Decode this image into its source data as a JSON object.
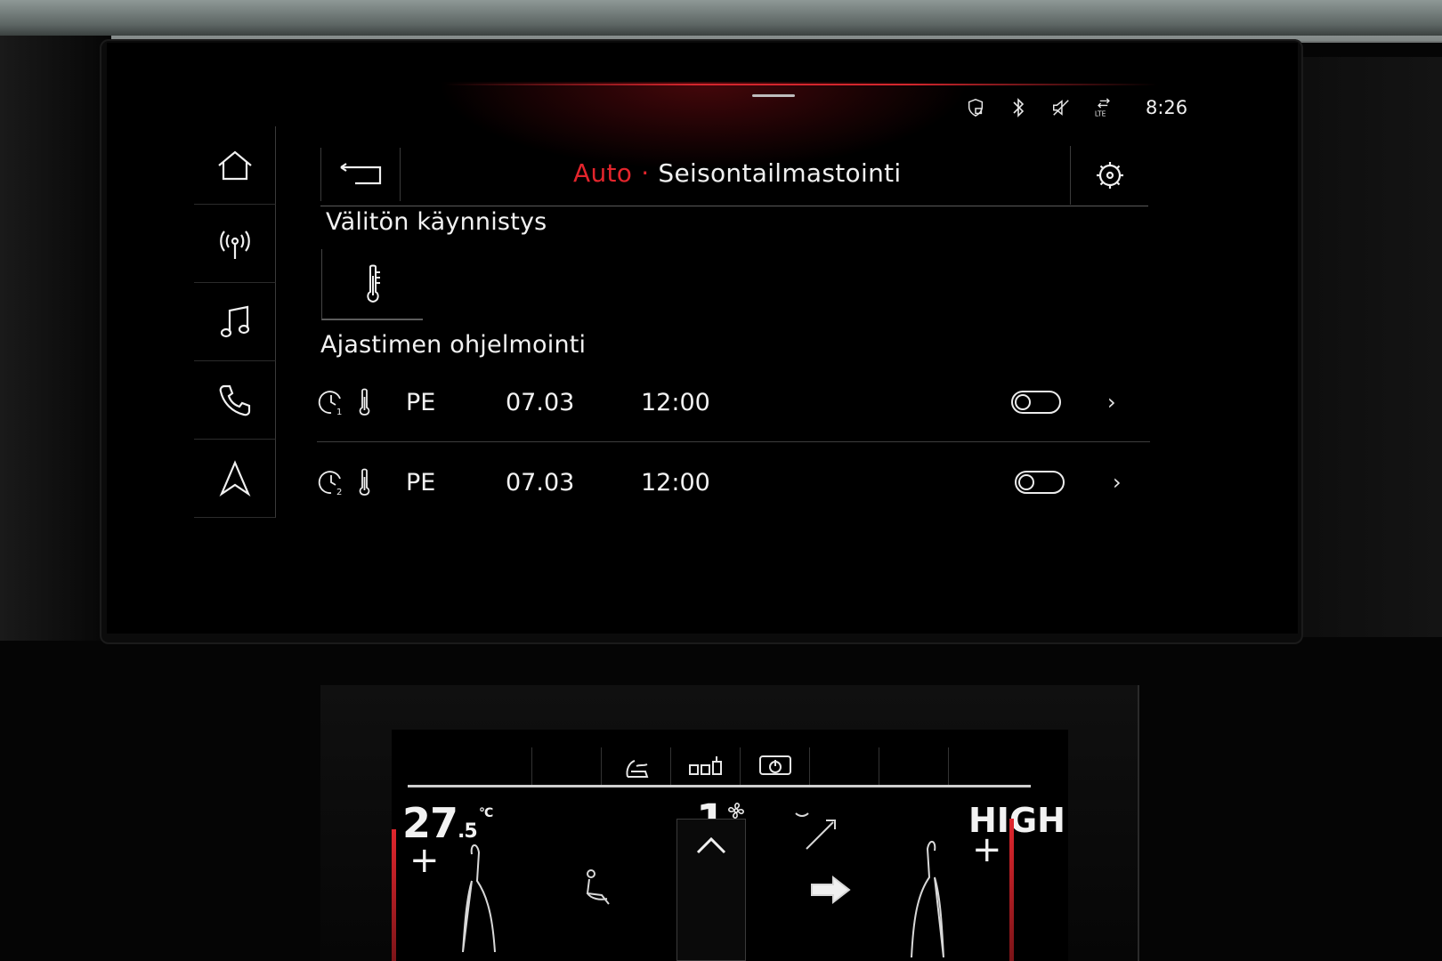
{
  "status_bar": {
    "icons": [
      "privacy-icon",
      "bluetooth-icon",
      "mute-icon",
      "lte-icon"
    ],
    "lte_label": "LTE",
    "clock": "8:26"
  },
  "sidebar": {
    "items": [
      {
        "name": "home",
        "icon": "home-icon"
      },
      {
        "name": "radio",
        "icon": "radio-icon"
      },
      {
        "name": "media",
        "icon": "music-icon"
      },
      {
        "name": "phone",
        "icon": "phone-icon"
      },
      {
        "name": "navigation",
        "icon": "navigation-icon"
      }
    ]
  },
  "header": {
    "breadcrumb_parent": "Auto",
    "breadcrumb_separator": "·",
    "title": "Seisontailmastointi"
  },
  "instant_start": {
    "title": "Välitön käynnistys",
    "tile_icon": "thermometer-icon"
  },
  "timer_programming": {
    "title": "Ajastimen ohjelmointi",
    "timers": [
      {
        "index": "1",
        "day": "PE",
        "date": "07.03",
        "time": "12:00",
        "enabled": false
      },
      {
        "index": "2",
        "day": "PE",
        "date": "07.03",
        "time": "12:00",
        "enabled": false
      }
    ]
  },
  "climate_panel": {
    "tabs": [
      "seat-heat-icon",
      "rear-climate-icon",
      "climate-power-icon"
    ],
    "left_temp": "27",
    "left_temp_decimal": ".5",
    "temp_unit": "°C",
    "fan_level": "1",
    "right_temp": "HIGH",
    "plus": "+"
  },
  "colors": {
    "accent_red": "#e3252c",
    "text": "#f0f0f0",
    "background": "#000000"
  }
}
